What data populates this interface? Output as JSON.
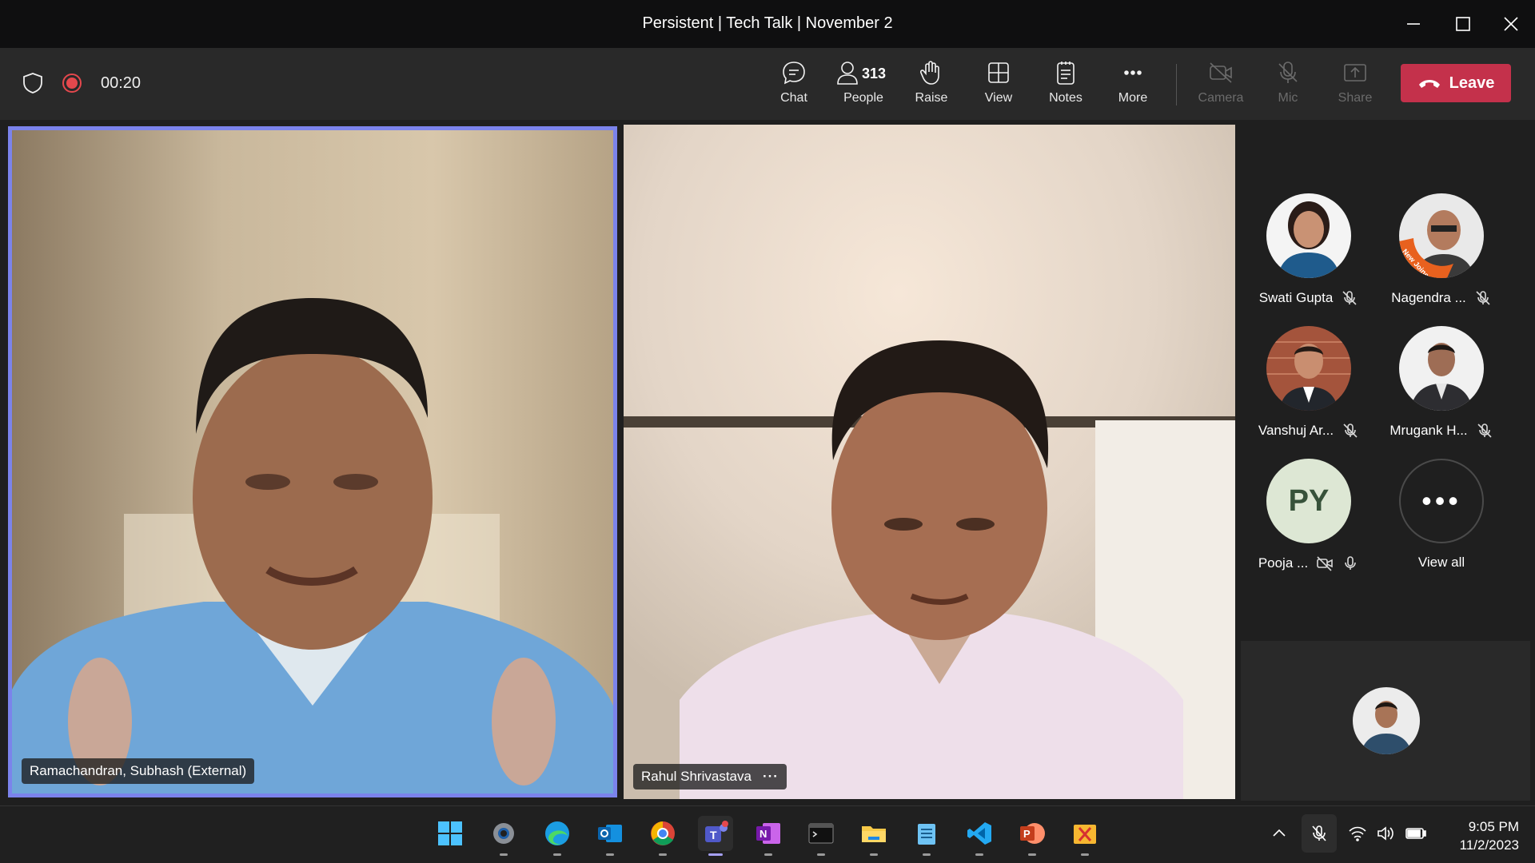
{
  "window": {
    "title": "Persistent | Tech Talk | November 2"
  },
  "toolbar": {
    "timer": "00:20",
    "chat_label": "Chat",
    "people_label": "People",
    "people_count": "313",
    "raise_label": "Raise",
    "view_label": "View",
    "notes_label": "Notes",
    "more_label": "More",
    "camera_label": "Camera",
    "mic_label": "Mic",
    "share_label": "Share",
    "leave_label": "Leave",
    "accent_leave": "#c4314b"
  },
  "stage": {
    "speaker1": {
      "name": "Ramachandran, Subhash (External)",
      "active_border": "#7b83eb"
    },
    "speaker2": {
      "name": "Rahul Shrivastava",
      "more": "···"
    }
  },
  "roster": [
    {
      "name": "Swati Gupta",
      "status": "muted"
    },
    {
      "name": "Nagendra ...",
      "status": "muted",
      "badge": "New Joiner"
    },
    {
      "name": "Vanshuj Ar...",
      "status": "muted"
    },
    {
      "name": "Mrugank H...",
      "status": "muted"
    },
    {
      "name": "Pooja ...",
      "initials": "PY",
      "status": "camera-off"
    },
    {
      "name": "View all",
      "icon": "more-dots"
    }
  ],
  "taskbar": {
    "apps": [
      "windows-start",
      "settings",
      "edge",
      "outlook",
      "chrome",
      "teams",
      "onenote",
      "terminal",
      "file-explorer",
      "notepad",
      "vscode",
      "powerpoint",
      "snipping-tool"
    ],
    "time": "9:05 PM",
    "date": "11/2/2023"
  }
}
